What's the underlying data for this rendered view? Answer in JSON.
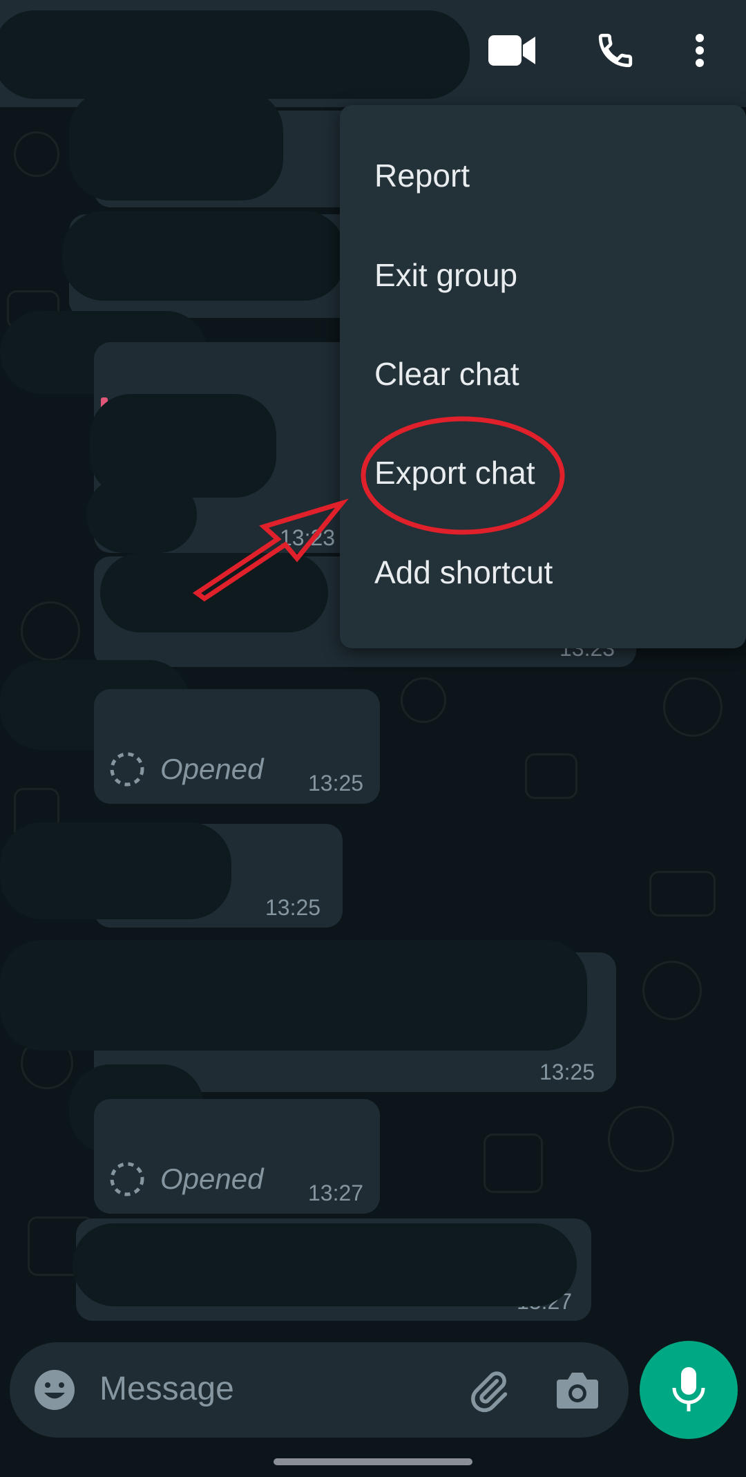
{
  "header": {
    "video_icon": "video-camera-icon",
    "call_icon": "phone-icon",
    "more_icon": "more-vertical-icon"
  },
  "menu": {
    "items": [
      {
        "label": "Report"
      },
      {
        "label": "Exit group"
      },
      {
        "label": "Clear chat"
      },
      {
        "label": "Export chat"
      },
      {
        "label": "Add shortcut"
      }
    ]
  },
  "messages": [
    {
      "time": "13:23"
    },
    {
      "time": "13:23"
    },
    {
      "status": "Opened",
      "time": "13:25"
    },
    {
      "time": "13:25"
    },
    {
      "time": "13:25"
    },
    {
      "status": "Opened",
      "time": "13:27"
    },
    {
      "time": "13:27"
    }
  ],
  "composer": {
    "placeholder": "Message",
    "emoji_icon": "emoji-icon",
    "attach_icon": "paperclip-icon",
    "camera_icon": "camera-icon",
    "mic_icon": "microphone-icon"
  },
  "colors": {
    "header": "#1f2c33",
    "bubble": "#1f2c33",
    "menu": "#233138",
    "accent": "#00a884",
    "annotation": "#e0202a"
  }
}
